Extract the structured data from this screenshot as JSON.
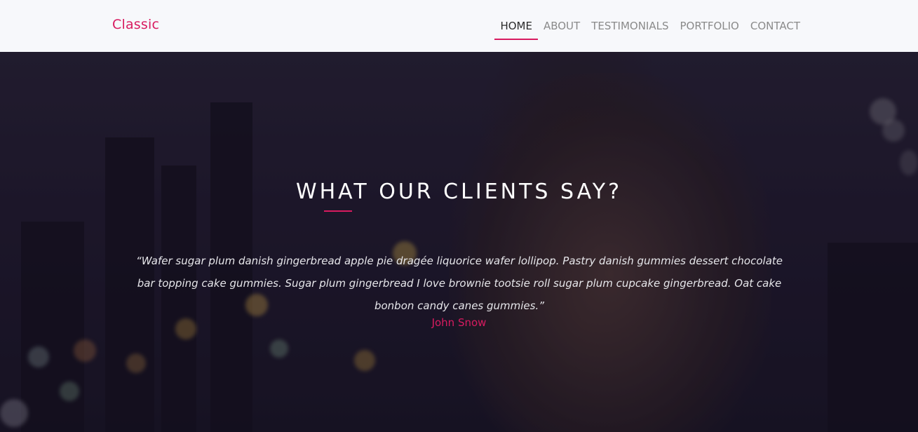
{
  "brand": {
    "name": "Classic",
    "color": "#d81b60"
  },
  "nav": {
    "items": [
      {
        "label": "HOME",
        "active": true
      },
      {
        "label": "ABOUT",
        "active": false
      },
      {
        "label": "TESTIMONIALS",
        "active": false
      },
      {
        "label": "PORTFOLIO",
        "active": false
      },
      {
        "label": "CONTACT",
        "active": false
      }
    ]
  },
  "testimonials": {
    "title": "WHAT OUR CLIENTS SAY?",
    "quote": "“Wafer sugar plum danish gingerbread apple pie dragée liquorice wafer lollipop. Pastry danish gummies dessert chocolate bar topping cake gummies. Sugar plum gingerbread I love brownie tootsie roll sugar plum cupcake gingerbread. Oat cake bonbon candy canes gummies.”",
    "author": "John Snow"
  },
  "colors": {
    "accent": "#d81b60",
    "navbar_bg": "#f7f8fb",
    "nav_text": "#8a8a8a",
    "nav_active_text": "#2b2b2b"
  }
}
